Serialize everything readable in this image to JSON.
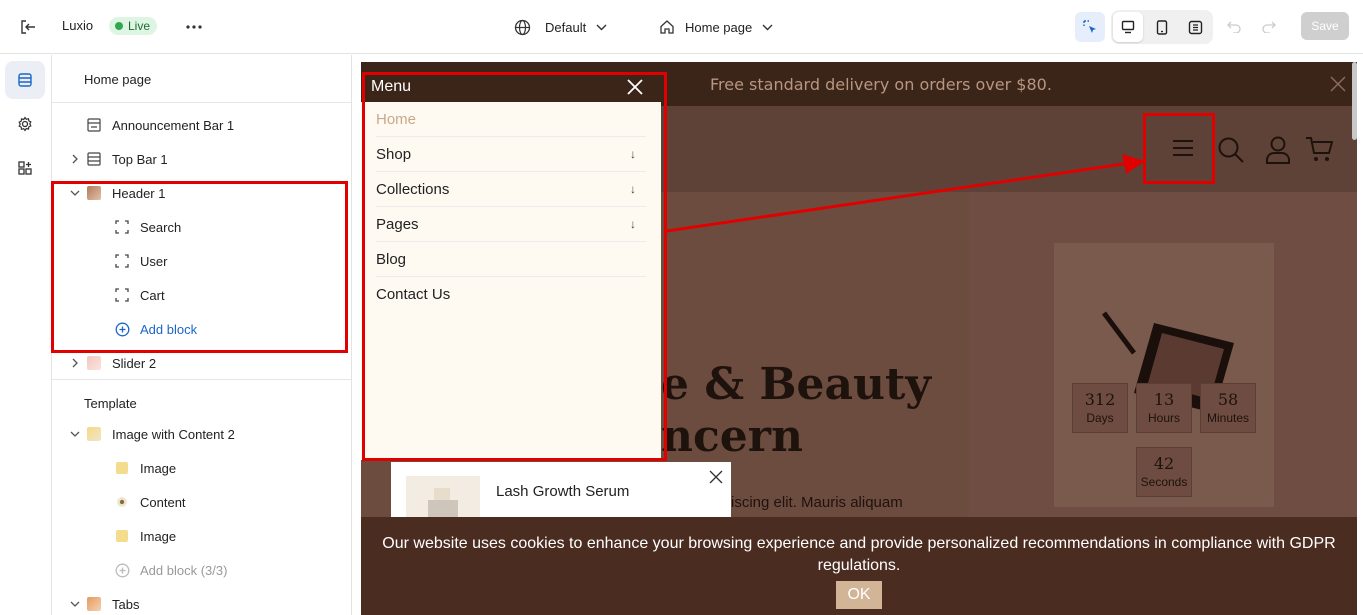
{
  "topbar": {
    "store_name": "Luxio",
    "status_badge": "Live",
    "theme_selector": "Default",
    "page_selector": "Home page",
    "save_label": "Save"
  },
  "rail": {
    "items": [
      "sections-icon",
      "settings-icon",
      "apps-icon"
    ]
  },
  "sidebar": {
    "header_title": "Home page",
    "header_items": [
      {
        "label": "Announcement Bar 1",
        "icon": "section-icon"
      },
      {
        "label": "Top Bar 1",
        "icon": "section-icon"
      },
      {
        "label": "Header 1",
        "icon": "header-thumb"
      }
    ],
    "header_blocks": [
      "Search",
      "User",
      "Cart"
    ],
    "add_block": "Add block",
    "slider": "Slider 2",
    "template_title": "Template",
    "template_section": "Image with Content 2",
    "template_blocks": [
      "Image",
      "Content",
      "Image"
    ],
    "template_add_block": "Add block (3/3)",
    "tabs": "Tabs"
  },
  "preview": {
    "announcement": "Free standard delivery on orders over $80.",
    "menu_title": "Menu",
    "menu_items": [
      {
        "label": "Home",
        "active": true,
        "has_sub": false
      },
      {
        "label": "Shop",
        "active": false,
        "has_sub": true
      },
      {
        "label": "Collections",
        "active": false,
        "has_sub": true
      },
      {
        "label": "Pages",
        "active": false,
        "has_sub": true
      },
      {
        "label": "Blog",
        "active": false,
        "has_sub": false
      },
      {
        "label": "Contact Us",
        "active": false,
        "has_sub": false
      }
    ],
    "hero_line1": "e & Beauty",
    "hero_line2": "ncern",
    "hero_text": "iscing elit. Mauris aliquam",
    "countdown": [
      {
        "value": "312",
        "unit": "Days"
      },
      {
        "value": "13",
        "unit": "Hours"
      },
      {
        "value": "58",
        "unit": "Minutes"
      },
      {
        "value": "42",
        "unit": "Seconds"
      }
    ],
    "popup_product": "Lash Growth Serum",
    "cookie_text": "Our website uses cookies to enhance your browsing experience and provide personalized recommendations in compliance with GDPR regulations.",
    "cookie_ok": "OK"
  },
  "colors": {
    "accent": "#1a66c8",
    "annotation": "#e00000",
    "live_green": "#2fa84f",
    "menu_active": "#c9a88a"
  }
}
